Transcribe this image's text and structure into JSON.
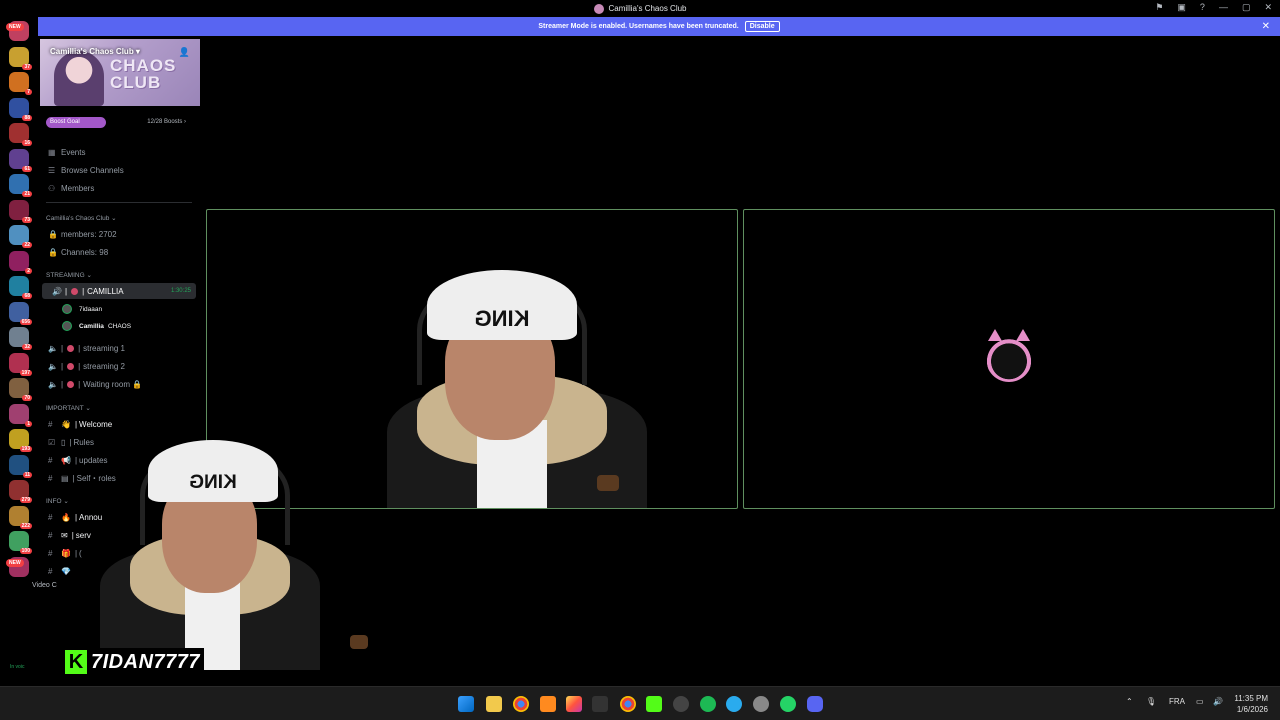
{
  "window": {
    "title": "Camillia's Chaos Club"
  },
  "banner": {
    "message": "Streamer Mode is enabled. Usernames have been truncated.",
    "disable_label": "Disable",
    "close_icon": "✕"
  },
  "server_rail": {
    "badges": [
      "NEW",
      "37",
      "7",
      "88",
      "16",
      "61",
      "21",
      "73",
      "22",
      "2",
      "68",
      "656",
      "32",
      "197",
      "70",
      "1",
      "193",
      "11",
      "279",
      "222",
      "100",
      "NEW"
    ]
  },
  "server": {
    "name": "Camillia's Chaos Club",
    "banner_text": "CHAOS CLUB",
    "boost_goal_label": "Boost Goal",
    "boost_count": "12/28 Boosts",
    "boost_progress": 0.43
  },
  "nav": {
    "events": "Events",
    "browse": "Browse Channels",
    "members": "Members"
  },
  "stats_category": "Camillia's Chaos Club",
  "stats": {
    "members": "members: 2702",
    "channels": "Channels: 98"
  },
  "streaming_category": "STREAMING",
  "voice": {
    "active_channel": "CAMILLIA",
    "active_timer": "1:30:25",
    "users": [
      "7idaaan",
      "Camillia"
    ],
    "user2_tag": "CHAOS",
    "other_channels": [
      "streaming 1",
      "streaming 2",
      "Waiting room 🔒"
    ]
  },
  "important_category": "IMPORTANT",
  "important_channels": [
    "Welcome",
    "Rules",
    "updates",
    "Self・roles"
  ],
  "info_category": "INFO",
  "info_channels": [
    "Annou",
    "serv",
    "("
  ],
  "bottom": {
    "video_label": "Video C",
    "in_voice": "In voic"
  },
  "streamer": {
    "name": "7IDAN7777",
    "logo_letter": "K"
  },
  "cam_text": {
    "hat": "KING"
  },
  "taskbar": {
    "lang": "FRA",
    "time": "11:35 PM",
    "date": "1/6/2026"
  }
}
